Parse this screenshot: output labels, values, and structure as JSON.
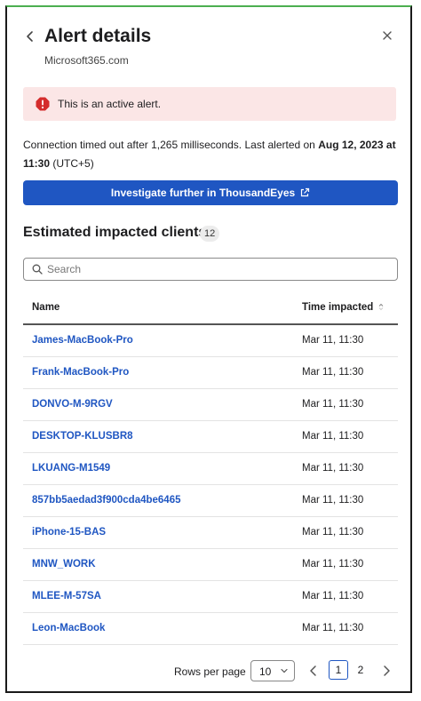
{
  "header": {
    "title": "Alert details",
    "subtitle": "Microsoft365.com"
  },
  "alert": {
    "text": "This is an active alert.",
    "color": "#fbe6e6",
    "icon_color": "#d42c2c"
  },
  "message": {
    "prefix": "Connection timed out after 1,265 milliseconds. Last alerted on ",
    "emphasis": "Aug 12, 2023 at 11:30",
    "suffix": " (UTC+5)"
  },
  "actions": {
    "investigate_label": "Investigate further in ThousandEyes"
  },
  "clients": {
    "title": "Estimated impacted clients",
    "count": "12",
    "search_placeholder": "Search",
    "columns": {
      "name": "Name",
      "time": "Time impacted"
    },
    "rows": [
      {
        "name": "James-MacBook-Pro",
        "time": "Mar 11, 11:30"
      },
      {
        "name": "Frank-MacBook-Pro",
        "time": "Mar 11, 11:30"
      },
      {
        "name": "DONVO-M-9RGV",
        "time": "Mar 11, 11:30"
      },
      {
        "name": "DESKTOP-KLUSBR8",
        "time": "Mar 11, 11:30"
      },
      {
        "name": "LKUANG-M1549",
        "time": "Mar 11, 11:30"
      },
      {
        "name": "857bb5aedad3f900cda4be6465",
        "time": "Mar 11, 11:30"
      },
      {
        "name": "iPhone-15-BAS",
        "time": "Mar 11, 11:30"
      },
      {
        "name": "MNW_WORK",
        "time": "Mar 11, 11:30"
      },
      {
        "name": "MLEE-M-57SA",
        "time": "Mar 11, 11:30"
      },
      {
        "name": "Leon-MacBook",
        "time": "Mar 11, 11:30"
      }
    ]
  },
  "pagination": {
    "rows_per_page_label": "Rows per page",
    "rows_per_page_value": "10",
    "pages": [
      "1",
      "2"
    ],
    "current_page": "1"
  },
  "colors": {
    "accent": "#1f56c2",
    "text": "#1d1d1f"
  }
}
